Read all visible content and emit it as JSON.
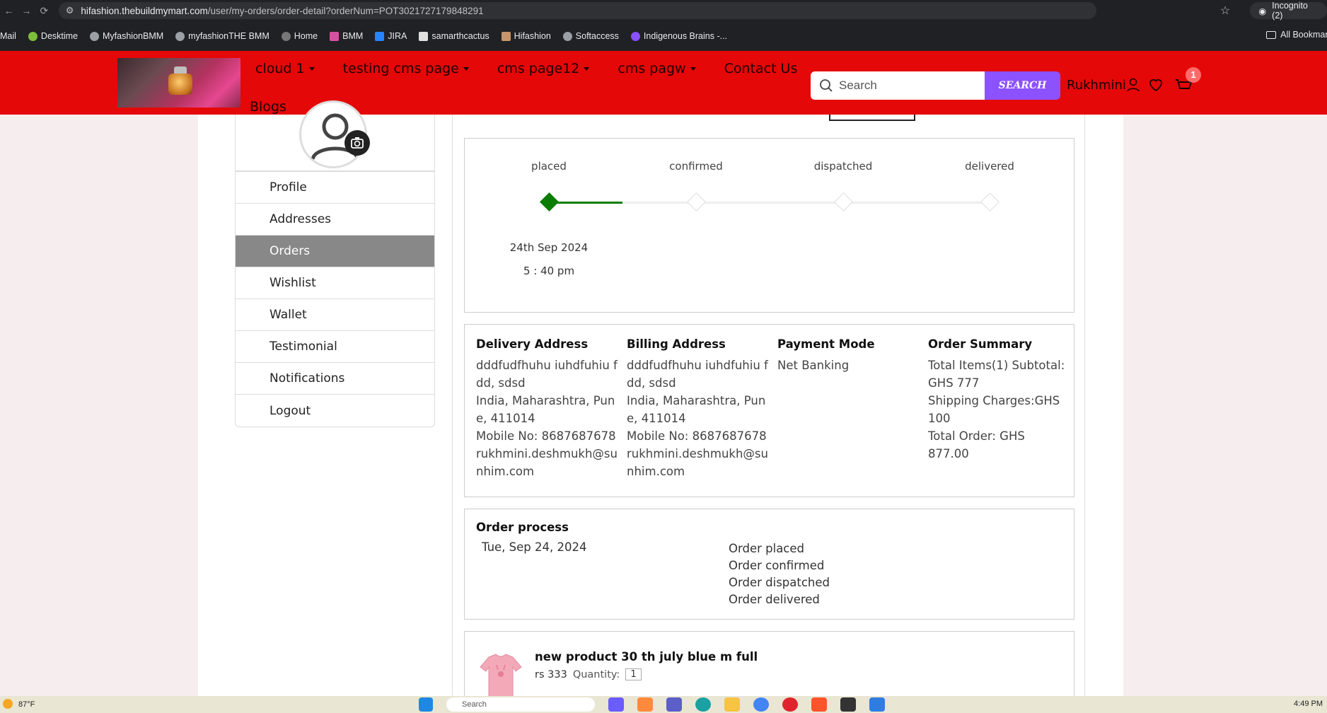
{
  "browser": {
    "url_host": "hifashion.thebuildmymart.com",
    "url_path": "/user/my-orders/order-detail?orderNum=POT3021727179848291",
    "incognito_label": "Incognito (2)",
    "bookmarks": [
      "Mail",
      "Desktime",
      "MyfashionBMM",
      "myfashionTHE BMM",
      "Home",
      "BMM",
      "JIRA",
      "samarthcactus",
      "Hifashion",
      "Softaccess",
      "Indigenous Brains -..."
    ],
    "all_bookmarks": "All Bookmarks"
  },
  "header": {
    "menu": [
      "cloud 1",
      "testing cms page",
      "cms page12",
      "cms pagw"
    ],
    "contact": "Contact Us",
    "blogs": "Blogs",
    "search_placeholder": "Search",
    "search_button": "SEARCH",
    "user_name": "Rukhmini",
    "cart_count": "1",
    "accent": "#e50808",
    "search_button_color": "#8c52ff"
  },
  "sidebar": {
    "items": [
      {
        "label": "Profile"
      },
      {
        "label": "Addresses"
      },
      {
        "label": "Orders"
      },
      {
        "label": "Wishlist"
      },
      {
        "label": "Wallet"
      },
      {
        "label": "Testimonial"
      },
      {
        "label": "Notifications"
      },
      {
        "label": "Logout"
      }
    ],
    "active": "Orders"
  },
  "tracker": {
    "stages": [
      "placed",
      "confirmed",
      "dispatched",
      "delivered"
    ],
    "completed_index": 0,
    "date": "24th Sep 2024",
    "time": "5 : 40 pm",
    "done_color": "#0a7d00"
  },
  "addresses": {
    "delivery": {
      "title": "Delivery Address",
      "lines": [
        "dddfudfhuhu iuhdfuhiu fdd, sdsd",
        "India, Maharashtra, Pune, 411014",
        "Mobile No: 8687687678",
        "rukhmini.deshmukh@sunhim.com"
      ]
    },
    "billing": {
      "title": "Billing Address",
      "lines": [
        "dddfudfhuhu iuhdfuhiu fdd, sdsd",
        "India, Maharashtra, Pune, 411014",
        "Mobile No: 8687687678",
        "rukhmini.deshmukh@sunhim.com"
      ]
    },
    "payment": {
      "title": "Payment Mode",
      "lines": [
        "Net Banking"
      ]
    },
    "summary": {
      "title": "Order Summary",
      "lines": [
        "Total Items(1) Subtotal: GHS 777",
        "Shipping Charges:GHS 100",
        "Total Order: GHS 877.00"
      ]
    }
  },
  "process": {
    "title": "Order process",
    "date": "Tue, Sep 24, 2024",
    "steps": [
      "Order placed",
      "Order confirmed",
      "Order dispatched",
      "Order delivered"
    ]
  },
  "product": {
    "name": "new product 30 th july blue m full",
    "price": "rs 333",
    "quantity_label": "Quantity:",
    "quantity": "1"
  },
  "taskbar": {
    "temperature": "87°F",
    "search": "Search",
    "time": "4:49 PM"
  }
}
